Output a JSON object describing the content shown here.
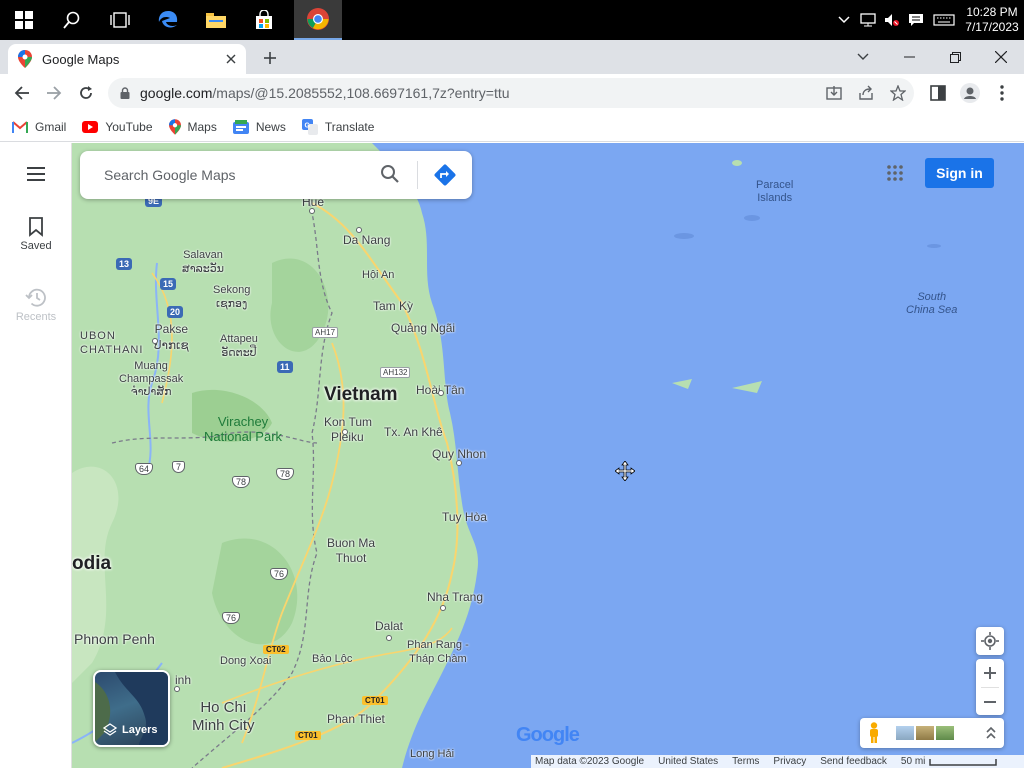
{
  "taskbar": {
    "time": "10:28 PM",
    "date": "7/17/2023",
    "icons": [
      "windows-start-icon",
      "search-icon",
      "task-view-icon",
      "edge-icon",
      "file-explorer-icon",
      "store-icon",
      "chrome-icon"
    ]
  },
  "browser": {
    "tab_title": "Google Maps",
    "url_main": "google.com",
    "url_path": "/maps/@15.2085552,108.6697161,7z?entry=ttu",
    "bookmarks": [
      "Gmail",
      "YouTube",
      "Maps",
      "News",
      "Translate"
    ]
  },
  "maps": {
    "search_placeholder": "Search Google Maps",
    "sign_in": "Sign in",
    "rail": {
      "saved": "Saved",
      "recents": "Recents"
    },
    "layers_label": "Layers",
    "labels": {
      "vietnam": "Vietnam",
      "cambodia": "odia",
      "hue": "Hue",
      "danang": "Da Nang",
      "hoian": "Hội An",
      "tamky": "Tam Kỳ",
      "quangngai": "Quảng Ngãi",
      "hoaitan": "Hoài Tân",
      "quynhon": "Quy Nhon",
      "kontum": "Kon Tum",
      "pleiku": "Pleiku",
      "txankhe": "Tx. An Khê",
      "tuyhoa": "Tuy Hòa",
      "buonmathuot_1": "Buon Ma",
      "buonmathuot_2": "Thuot",
      "nhatrang": "Nha Trang",
      "dalat": "Dalat",
      "phanrang_1": "Phan Rang -",
      "phanrang_2": "Tháp Chàm",
      "baoloc": "Bảo Lộc",
      "phanthiet": "Phan Thiet",
      "longhai": "Long Hải",
      "hochiminh_1": "Ho Chi",
      "hochiminh_2": "Minh City",
      "dongxoai": "Dong Xoai",
      "phnompenh": "Phnom Penh",
      "salavan": "Salavan",
      "salavan_lao": "ສາລະວັນ",
      "sekong": "Sekong",
      "sekong_lao": "ເຊກອງ",
      "pakse": "Pakse",
      "pakse_lao": "ປາກເຊ",
      "attapeu": "Attapeu",
      "attapeu_lao": "ອັດຕະປື",
      "muang": "Muang",
      "champassak": "Champassak",
      "champassak_lao": "ຈຳປາສັກ",
      "ubon": "UBON",
      "ratchathani": "CHATHANI",
      "virachey_1": "Virachey",
      "virachey_2": "National Park",
      "paracel_1": "Paracel",
      "paracel_2": "Islands",
      "southchinasea_1": "South",
      "southchinasea_2": "China Sea",
      "inh": "inh"
    },
    "roads": {
      "h9e": "9E",
      "h13": "13",
      "h15": "15",
      "h20": "20",
      "h11": "11",
      "ah17": "AH17",
      "ah132": "AH132",
      "s64": "64",
      "s7": "7",
      "s78_1": "78",
      "s78_2": "78",
      "s76_1": "76",
      "s76_2": "76",
      "ct02": "CT02",
      "ct01_1": "CT01",
      "ct01_2": "CT01"
    },
    "footer": [
      "Map data ©2023 Google",
      "United States",
      "Terms",
      "Privacy",
      "Send feedback",
      "50 mi"
    ],
    "google_logo": "Google"
  },
  "colors": {
    "land": "#b7dfb1",
    "water": "#7ba7f2",
    "accent": "#1a73e8"
  }
}
